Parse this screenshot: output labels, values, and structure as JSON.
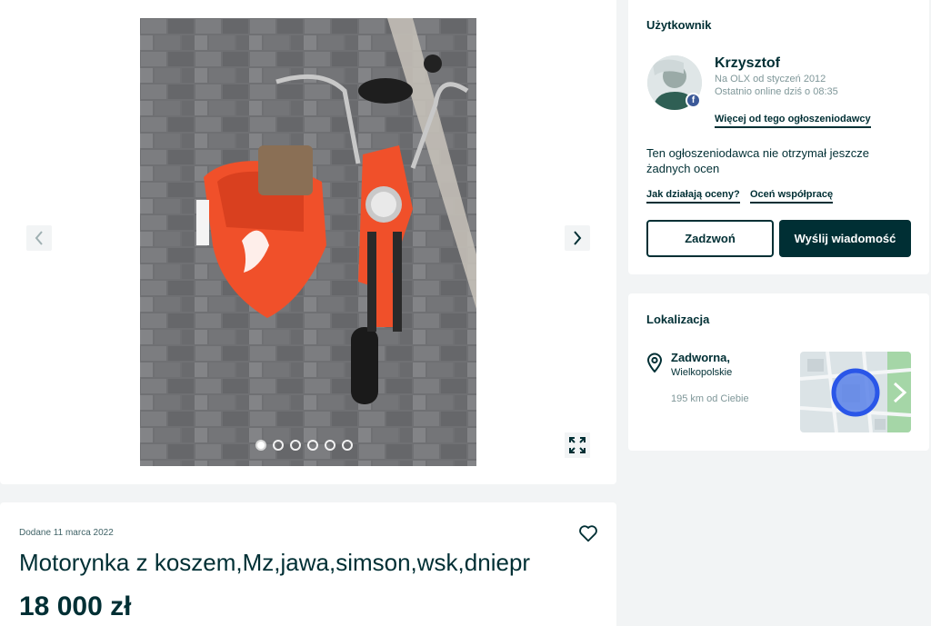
{
  "gallery": {
    "image_alt": "Motorynka z koszem",
    "prev_icon": "chevron-left-icon",
    "next_icon": "chevron-right-icon",
    "fullscreen_icon": "expand-icon",
    "dots_total": 6,
    "dot_active": 1
  },
  "ad": {
    "added": "Dodane 11 marca 2022",
    "title": "Motorynka z koszem,Mz,jawa,simson,wsk,dniepr",
    "price": "18 000 zł",
    "favorite_icon": "heart-icon"
  },
  "user": {
    "section_title": "Użytkownik",
    "name": "Krzysztof",
    "member_since": "Na OLX od styczeń 2012",
    "last_online": "Ostatnio online dziś o 08:35",
    "more_link": "Więcej od tego ogłoszeniodawcy",
    "rating_text": "Ten ogłoszeniodawca nie otrzymał jeszcze żadnych ocen",
    "how_ratings_link": "Jak działają oceny?",
    "rate_link": "Oceń współpracę",
    "call_button": "Zadzwoń",
    "message_button": "Wyślij wiadomość",
    "badge": "f"
  },
  "location": {
    "section_title": "Lokalizacja",
    "city": "Zadworna,",
    "region": "Wielkopolskie",
    "distance": "195 km od Ciebie"
  },
  "colors": {
    "primary": "#002f34",
    "background": "#f2f4f5",
    "muted": "#7f9799",
    "map_marker": "#2a56e8"
  }
}
